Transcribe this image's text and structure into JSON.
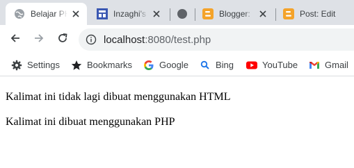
{
  "tabs": [
    {
      "title": "Belajar PHP",
      "active": true
    },
    {
      "title": "Inzaghi's",
      "active": false
    },
    {
      "title": "",
      "active": false
    },
    {
      "title": "Blogger: ",
      "active": false
    },
    {
      "title": "Post: Edit",
      "active": false
    }
  ],
  "address_bar": {
    "host": "localhost",
    "rest": ":8080/test.php"
  },
  "bookmarks": [
    {
      "label": "Settings",
      "icon": "gear-icon"
    },
    {
      "label": "Bookmarks",
      "icon": "star-icon"
    },
    {
      "label": "Google",
      "icon": "google-icon"
    },
    {
      "label": "Bing",
      "icon": "search-icon"
    },
    {
      "label": "YouTube",
      "icon": "youtube-icon"
    },
    {
      "label": "Gmail",
      "icon": "gmail-icon"
    }
  ],
  "page": {
    "line1": "Kalimat ini tidak lagi dibuat menggunakan HTML",
    "line2": "Kalimat ini dibuat menggunakan PHP"
  },
  "colors": {
    "tabstrip": "#dee1e6",
    "omnibox": "#f1f3f4",
    "blogger_orange": "#f4a32a",
    "youtube_red": "#ff0000",
    "inzaghi_blue": "#3a57b2"
  }
}
